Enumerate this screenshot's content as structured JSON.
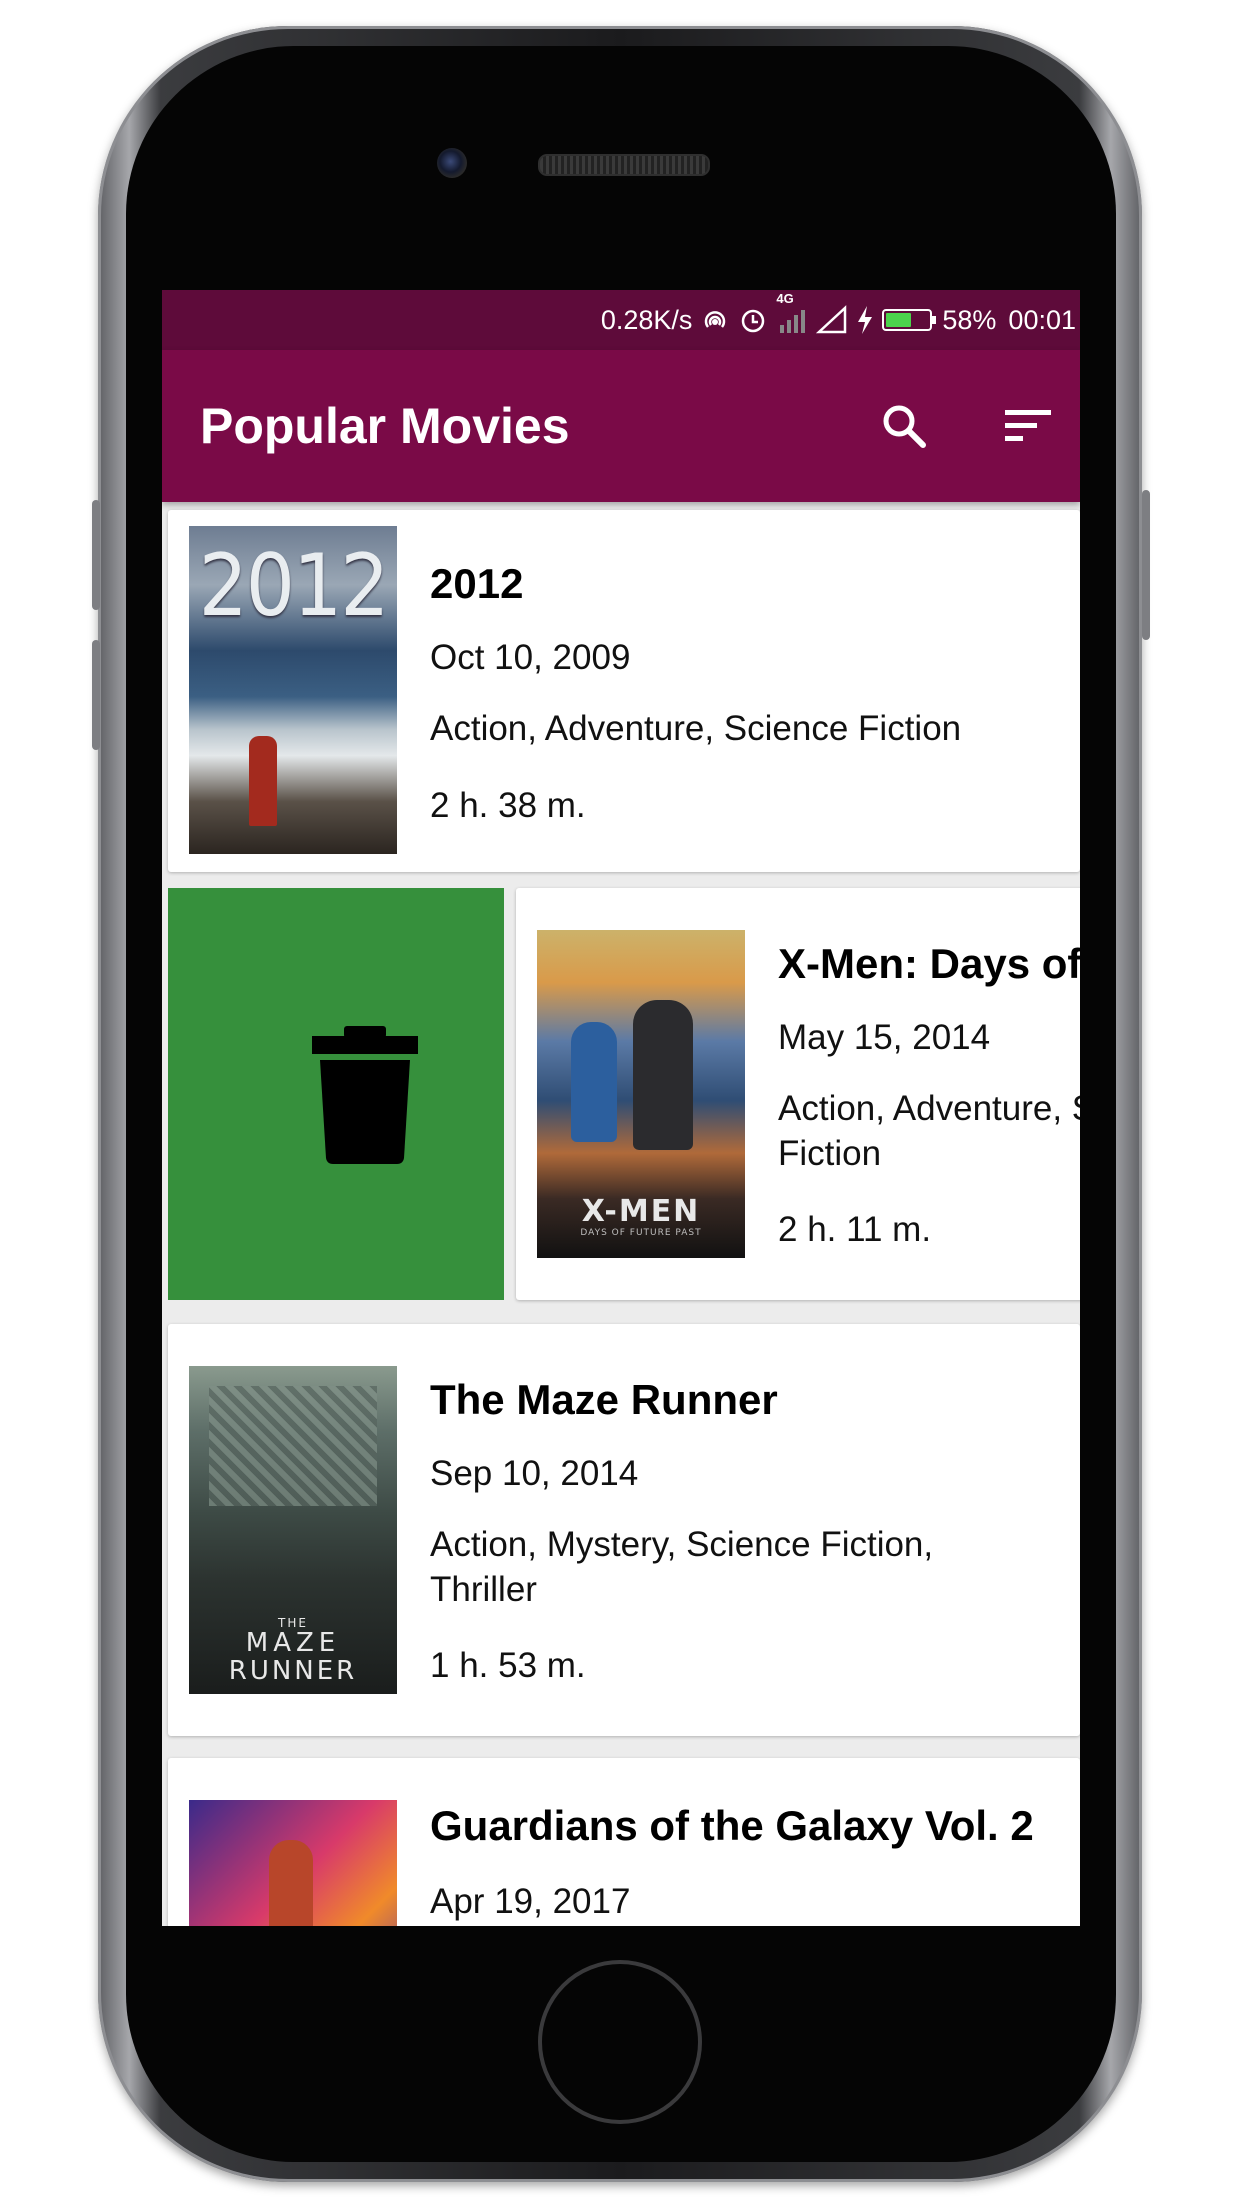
{
  "status_bar": {
    "speed": "0.28K/s",
    "network_badge": "4G",
    "battery": "58%",
    "battery_level": 0.58,
    "time": "00:01"
  },
  "toolbar": {
    "title": "Popular Movies",
    "search_icon": "search-icon",
    "sort_icon": "sort-icon"
  },
  "colors": {
    "status_bar": "#5e0b3a",
    "toolbar": "#7a0a47",
    "swipe_delete": "#36903c"
  },
  "swipe_action": {
    "icon": "trash-icon"
  },
  "movies": [
    {
      "title": "2012",
      "date": "Oct 10, 2009",
      "genres": "Action, Adventure, Science Fiction",
      "duration": "2 h. 38 m.",
      "poster_text": "2012"
    },
    {
      "title": "X-Men: Days of F",
      "date": "May 15, 2014",
      "genres_line1": "Action, Adventure, S",
      "genres_line2": "Fiction",
      "duration": "2 h. 11 m.",
      "poster_text": "X-MEN",
      "poster_subtext": "DAYS OF FUTURE PAST"
    },
    {
      "title": "The Maze Runner",
      "date": "Sep 10, 2014",
      "genres_line1": "Action, Mystery, Science Fiction,",
      "genres_line2": "Thriller",
      "duration": "1 h. 53 m.",
      "poster_text_small": "THE",
      "poster_text_line1": "MAZE",
      "poster_text_line2": "RUNNER"
    },
    {
      "title": "Guardians of the Galaxy Vol. 2",
      "date": "Apr 19, 2017"
    }
  ]
}
